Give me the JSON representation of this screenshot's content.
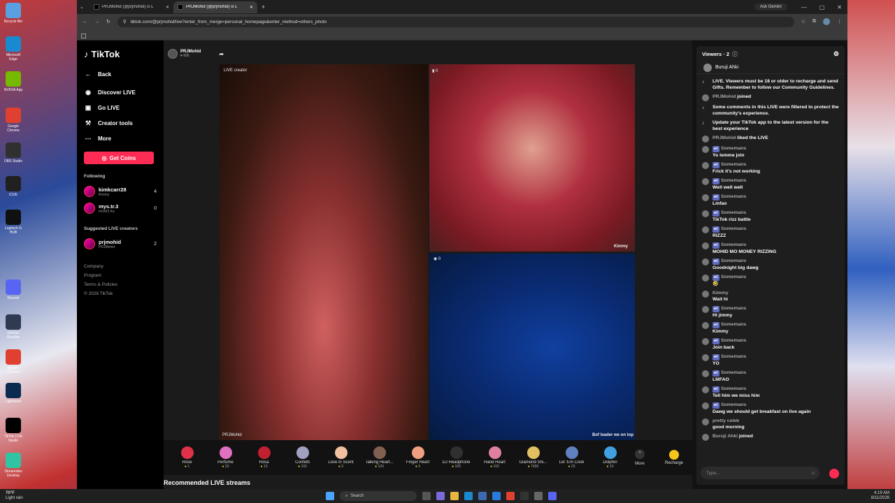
{
  "desktop": {
    "icons": [
      {
        "label": "Recycle Bin",
        "color": "#5aa0e0"
      },
      {
        "label": "Microsoft Edge",
        "color": "#1a8ad0"
      },
      {
        "label": "NVIDIA App",
        "color": "#76b900"
      },
      {
        "label": "Google Chrome",
        "color": "#e04030"
      },
      {
        "label": "OBS Studio",
        "color": "#303030"
      },
      {
        "label": "iCUE",
        "color": "#202020"
      },
      {
        "label": "Logitech G HUB",
        "color": "#101010"
      },
      {
        "label": "Discord",
        "color": "#5865f2"
      },
      {
        "label": "DaVinci Resolve",
        "color": "#303a50"
      },
      {
        "label": "Abdul - Chrome",
        "color": "#e04030"
      },
      {
        "label": "Lightroom",
        "color": "#0a2a50"
      },
      {
        "label": "TikTok LIVE Studio",
        "color": "#000000"
      },
      {
        "label": "Streamlabs Desktop",
        "color": "#31c3a2"
      }
    ]
  },
  "browser": {
    "tabs": [
      {
        "title": "PRJMohid (@prjmohid) is L"
      },
      {
        "title": "PRJMohid (@prjmohid) is L"
      }
    ],
    "gemini_label": "Ask Gemini",
    "url": "tiktok.com/@prjmohid/live?enter_from_merge=personal_homepage&enter_method=others_photo"
  },
  "sidebar": {
    "logo": "TikTok",
    "back": "Back",
    "nav": [
      {
        "label": "Discover LIVE",
        "icon": "live-icon"
      },
      {
        "label": "Go LIVE",
        "icon": "camera-icon"
      },
      {
        "label": "Creator tools",
        "icon": "tools-icon"
      },
      {
        "label": "More",
        "icon": "more-icon"
      }
    ],
    "coins_button": "Get Coins",
    "following_title": "Following",
    "following": [
      {
        "name": "kimkcarr28",
        "sub": "Kimmy",
        "count": "4"
      },
      {
        "name": "mys.tr.3",
        "sub": "m!stfr3 Ke",
        "count": "0"
      }
    ],
    "suggested_title": "Suggested LIVE creators",
    "suggested": [
      {
        "name": "prjmohid",
        "sub": "PRJMohid",
        "count": "2"
      }
    ],
    "footer": [
      "Company",
      "Program",
      "Terms & Policies",
      "© 2026 TikTok"
    ]
  },
  "stream": {
    "host_name": "PRJMohid",
    "host_viewers": "666",
    "main_label": "LIVE creator",
    "main_name": "PRJMohid",
    "top_score": "0",
    "top_name": "Kimmy",
    "bottom_score": "0",
    "bottom_caption": "Bof leader we on top",
    "gifts": [
      {
        "name": "Rose",
        "price": "1",
        "color": "#e0304a"
      },
      {
        "name": "Perfume",
        "price": "20",
        "color": "#e070c0"
      },
      {
        "name": "Rosa",
        "price": "10",
        "color": "#c02030"
      },
      {
        "name": "Confetti",
        "price": "100",
        "color": "#a0a0c0"
      },
      {
        "name": "Love in Scent",
        "price": "5",
        "color": "#f0c0a0"
      },
      {
        "name": "Talking Heart...",
        "price": "100",
        "color": "#806050"
      },
      {
        "name": "Finger Heart",
        "price": "5",
        "color": "#f0a080"
      },
      {
        "name": "DJ Headphone",
        "price": "100",
        "color": "#303030"
      },
      {
        "name": "Hand Heart",
        "price": "100",
        "color": "#e080a0"
      },
      {
        "name": "Diamond Shi...",
        "price": "7999",
        "color": "#e0c060"
      },
      {
        "name": "Let 'Em Cook",
        "price": "20",
        "color": "#6080c0"
      },
      {
        "name": "Dolphin",
        "price": "10",
        "color": "#40a0e0"
      }
    ],
    "more_label": "More",
    "recharge_label": "Recharge",
    "recommended": "Recommended LIVE streams"
  },
  "chat": {
    "title": "Viewers · 2",
    "viewer": "Buruji Ahki",
    "messages": [
      {
        "type": "sys",
        "text": "LIVE. Viewers must be 18 or older to recharge and send Gifts. Remember to follow our Community Guidelines."
      },
      {
        "type": "join",
        "user": "PRJMohid",
        "text": "joined"
      },
      {
        "type": "sys",
        "text": "Some comments in this LIVE were filtered to protect the community's experience."
      },
      {
        "type": "sys",
        "text": "Update your TikTok app to the latest version for the best experience"
      },
      {
        "type": "like",
        "user": "PRJMohid",
        "text": "liked the LIVE"
      },
      {
        "type": "msg",
        "user": "Somemans",
        "text": "Yo lemme join"
      },
      {
        "type": "msg",
        "user": "Somemans",
        "text": "Frick it's not working"
      },
      {
        "type": "msg",
        "user": "Somemans",
        "text": "Well well well"
      },
      {
        "type": "msg",
        "user": "Somemans",
        "text": "Lmfao"
      },
      {
        "type": "msg",
        "user": "Somemans",
        "text": "TikTok rizz battle"
      },
      {
        "type": "msg",
        "user": "Somemans",
        "text": "RIZZZ"
      },
      {
        "type": "msg",
        "user": "Somemans",
        "text": "MOHID MO MONEY RIZZING"
      },
      {
        "type": "msg",
        "user": "Somemans",
        "text": "Goodnight big dawg"
      },
      {
        "type": "msg",
        "user": "Somemans",
        "text": "🤣"
      },
      {
        "type": "msg",
        "user": "Kimmy",
        "text": "Wait hi"
      },
      {
        "type": "msg",
        "user": "Somemans",
        "text": "Hi jimmy"
      },
      {
        "type": "msg",
        "user": "Somemans",
        "text": "Kimmy"
      },
      {
        "type": "msg",
        "user": "Somemans",
        "text": "Join back"
      },
      {
        "type": "msg",
        "user": "Somemans",
        "text": "YO"
      },
      {
        "type": "msg",
        "user": "Somemans",
        "text": "LMFAO"
      },
      {
        "type": "msg",
        "user": "Somemans",
        "text": "Tell him we miss him"
      },
      {
        "type": "msg",
        "user": "Somemans",
        "text": "Dawg we should get breakfast on live again"
      },
      {
        "type": "msg",
        "user": "pretty celeb",
        "text": "good morning"
      },
      {
        "type": "join",
        "user": "Buruji Ahki",
        "text": "joined"
      }
    ],
    "input_placeholder": "Type..."
  },
  "taskbar": {
    "temp": "70°F",
    "weather": "Light rain",
    "search": "Search",
    "time": "4:19 AM",
    "date": "8/11/2026"
  }
}
